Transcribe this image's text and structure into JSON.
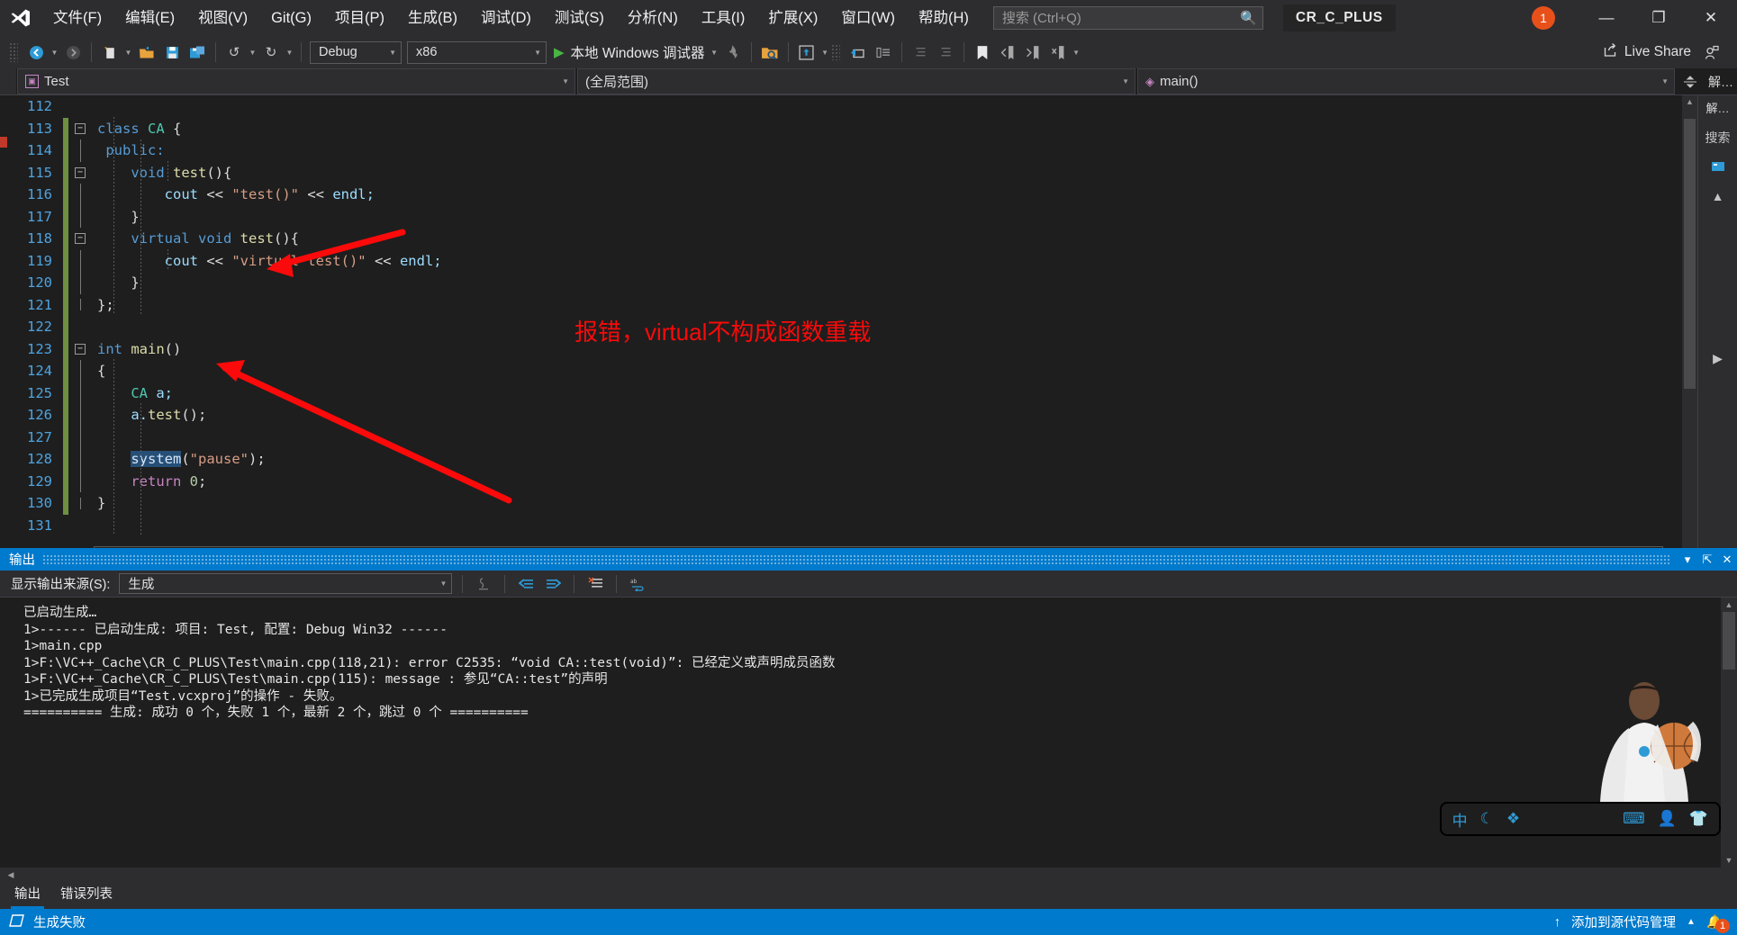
{
  "titlebar": {
    "logo_icon": "visual-studio-logo",
    "menus": [
      {
        "label": "文件(F)",
        "key": "F"
      },
      {
        "label": "编辑(E)",
        "key": "E"
      },
      {
        "label": "视图(V)",
        "key": "V"
      },
      {
        "label": "Git(G)",
        "key": "G"
      },
      {
        "label": "项目(P)",
        "key": "P"
      },
      {
        "label": "生成(B)",
        "key": "B"
      },
      {
        "label": "调试(D)",
        "key": "D"
      },
      {
        "label": "测试(S)",
        "key": "S"
      },
      {
        "label": "分析(N)",
        "key": "N"
      },
      {
        "label": "工具(I)",
        "key": "I"
      },
      {
        "label": "扩展(X)",
        "key": "X"
      },
      {
        "label": "窗口(W)",
        "key": "W"
      },
      {
        "label": "帮助(H)",
        "key": "H"
      }
    ],
    "search": {
      "placeholder": "搜索 (Ctrl+Q)",
      "value": "",
      "icon": "search-icon"
    },
    "solution_name": "CR_C_PLUS",
    "notification_count": "1",
    "window_buttons": {
      "minimize": "—",
      "maximize": "❐",
      "close": "✕"
    }
  },
  "toolbar": {
    "nav_back_icon": "navigate-back-icon",
    "nav_forward_icon": "navigate-forward-icon",
    "new_file_icon": "new-file-icon",
    "open_file_icon": "open-file-icon",
    "save_icon": "save-icon",
    "save_all_icon": "save-all-icon",
    "undo_icon": "undo-icon",
    "redo_icon": "redo-icon",
    "configuration": "Debug",
    "platform": "x86",
    "run_label": "本地 Windows 调试器",
    "hot_reload_icon": "hot-reload-icon",
    "search_folder_icon": "search-folder-icon",
    "solution_explorer_icon": "solution-explorer-icon",
    "properties_icon": "properties-icon",
    "toolbox_icon": "toolbox-icon",
    "indent_icons": [
      "decrease-indent-icon",
      "increase-indent-icon"
    ],
    "bookmark_icon": "bookmark-icon",
    "prev_bookmark_icon": "previous-bookmark-icon",
    "next_bookmark_icon": "next-bookmark-icon",
    "clear_bookmark_icon": "clear-bookmark-icon",
    "overflow_icon": "overflow-chevron-icon",
    "live_share_label": "Live Share",
    "live_share_icon": "share-icon",
    "account_icon": "account-icon"
  },
  "navbar": {
    "project": "Test",
    "project_icon": "project-icon",
    "scope": "(全局范围)",
    "member": "main()",
    "member_icon": "method-icon",
    "split_icon": "split-editor-icon",
    "right_label": "解…"
  },
  "editor": {
    "first_line": 112,
    "lines": [
      {
        "n": "112",
        "changed": false,
        "fold": "",
        "tokens": [
          {
            "t": "",
            "c": "pl"
          }
        ]
      },
      {
        "n": "113",
        "changed": true,
        "fold": "minus",
        "tokens": [
          {
            "t": "class ",
            "c": "kw"
          },
          {
            "t": "CA ",
            "c": "typ"
          },
          {
            "t": "{",
            "c": "pl"
          }
        ]
      },
      {
        "n": "114",
        "changed": true,
        "fold": "line",
        "tokens": [
          {
            "t": " public:",
            "c": "kw"
          }
        ]
      },
      {
        "n": "115",
        "changed": true,
        "fold": "minus",
        "tokens": [
          {
            "t": "    ",
            "c": "pl"
          },
          {
            "t": "void ",
            "c": "kw"
          },
          {
            "t": "test",
            "c": "fn"
          },
          {
            "t": "(){",
            "c": "pl"
          }
        ]
      },
      {
        "n": "116",
        "changed": true,
        "fold": "line",
        "tokens": [
          {
            "t": "        ",
            "c": "pl"
          },
          {
            "t": "cout ",
            "c": "var"
          },
          {
            "t": "<< ",
            "c": "pl"
          },
          {
            "t": "\"test()\"",
            "c": "str"
          },
          {
            "t": " << ",
            "c": "pl"
          },
          {
            "t": "endl;",
            "c": "var"
          }
        ]
      },
      {
        "n": "117",
        "changed": true,
        "fold": "line",
        "tokens": [
          {
            "t": "    }",
            "c": "pl"
          }
        ]
      },
      {
        "n": "118",
        "changed": true,
        "fold": "minus",
        "tokens": [
          {
            "t": "    ",
            "c": "pl"
          },
          {
            "t": "virtual void ",
            "c": "kw"
          },
          {
            "t": "test",
            "c": "fn"
          },
          {
            "t": "(){",
            "c": "pl"
          }
        ]
      },
      {
        "n": "119",
        "changed": true,
        "fold": "line",
        "tokens": [
          {
            "t": "        ",
            "c": "pl"
          },
          {
            "t": "cout ",
            "c": "var"
          },
          {
            "t": "<< ",
            "c": "pl"
          },
          {
            "t": "\"virtual test()\"",
            "c": "str"
          },
          {
            "t": " << ",
            "c": "pl"
          },
          {
            "t": "endl;",
            "c": "var"
          }
        ]
      },
      {
        "n": "120",
        "changed": true,
        "fold": "line",
        "tokens": [
          {
            "t": "    }",
            "c": "pl"
          }
        ]
      },
      {
        "n": "121",
        "changed": true,
        "fold": "end",
        "tokens": [
          {
            "t": "};",
            "c": "pl"
          }
        ]
      },
      {
        "n": "122",
        "changed": true,
        "fold": "",
        "tokens": [
          {
            "t": "",
            "c": "pl"
          }
        ]
      },
      {
        "n": "123",
        "changed": true,
        "fold": "minus",
        "tokens": [
          {
            "t": "int ",
            "c": "kw"
          },
          {
            "t": "main",
            "c": "fn"
          },
          {
            "t": "()",
            "c": "pl"
          }
        ]
      },
      {
        "n": "124",
        "changed": true,
        "fold": "line",
        "tokens": [
          {
            "t": "{",
            "c": "pl"
          }
        ]
      },
      {
        "n": "125",
        "changed": true,
        "fold": "line",
        "tokens": [
          {
            "t": "    ",
            "c": "pl"
          },
          {
            "t": "CA ",
            "c": "typ"
          },
          {
            "t": "a;",
            "c": "var"
          }
        ]
      },
      {
        "n": "126",
        "changed": true,
        "fold": "line",
        "tokens": [
          {
            "t": "    ",
            "c": "pl"
          },
          {
            "t": "a.",
            "c": "var"
          },
          {
            "t": "test",
            "c": "fn"
          },
          {
            "t": "();",
            "c": "pl"
          }
        ]
      },
      {
        "n": "127",
        "changed": true,
        "fold": "line",
        "tokens": [
          {
            "t": "",
            "c": "pl"
          }
        ]
      },
      {
        "n": "128",
        "changed": true,
        "fold": "line",
        "tokens": [
          {
            "t": "    ",
            "c": "pl"
          },
          {
            "t": "system",
            "c": "sel-word"
          },
          {
            "t": "(",
            "c": "pl"
          },
          {
            "t": "\"pause\"",
            "c": "str"
          },
          {
            "t": ");",
            "c": "pl"
          }
        ]
      },
      {
        "n": "129",
        "changed": true,
        "fold": "line",
        "tokens": [
          {
            "t": "    ",
            "c": "pl"
          },
          {
            "t": "return ",
            "c": "kw2"
          },
          {
            "t": "0",
            "c": "num"
          },
          {
            "t": ";",
            "c": "pl"
          }
        ]
      },
      {
        "n": "130",
        "changed": true,
        "fold": "end",
        "tokens": [
          {
            "t": "}",
            "c": "pl"
          }
        ]
      },
      {
        "n": "131",
        "changed": false,
        "fold": "",
        "tokens": [
          {
            "t": "",
            "c": "pl"
          }
        ]
      }
    ],
    "annotation": {
      "text": "报错，virtual不构成函数重载",
      "color": "#fa0a0a"
    }
  },
  "output": {
    "panel_title": "输出",
    "pin_icon": "pin-icon",
    "dropdown_icon": "window-menu-icon",
    "close_icon": "close-icon",
    "source_label": "显示输出来源(S):",
    "source_value": "生成",
    "toolbar_icons": [
      "find-message-icon",
      "go-to-previous-icon",
      "go-to-next-icon",
      "clear-all-icon",
      "toggle-word-wrap-icon"
    ],
    "lines": [
      "已启动生成…",
      "1>------ 已启动生成: 项目: Test, 配置: Debug Win32 ------",
      "1>main.cpp",
      "1>F:\\VC++_Cache\\CR_C_PLUS\\Test\\main.cpp(118,21): error C2535: “void CA::test(void)”: 已经定义或声明成员函数",
      "1>F:\\VC++_Cache\\CR_C_PLUS\\Test\\main.cpp(115): message : 参见“CA::test”的声明",
      "1>已完成生成项目“Test.vcxproj”的操作 - 失败。",
      "========== 生成: 成功 0 个，失败 1 个，最新 2 个，跳过 0 个 =========="
    ]
  },
  "float_toolbar": {
    "icons": [
      "aim-icon",
      "moon-icon",
      "sparkle-icon",
      "keyboard-icon",
      "person-icon",
      "shirt-icon"
    ]
  },
  "bottom_tabs": [
    {
      "label": "输出",
      "active": true
    },
    {
      "label": "错误列表",
      "active": false
    }
  ],
  "statusbar": {
    "status_icon": "build-status-icon",
    "status_text": "生成失败",
    "source_control_label": "添加到源代码管理",
    "source_control_up_icon": "arrow-up-icon",
    "source_control_caret": "caret-up-icon",
    "bell_icon": "bell-icon",
    "bell_count": "1"
  },
  "colors": {
    "accent": "#007acc",
    "titlebar_bg": "#2d2d30",
    "editor_bg": "#1e1e1e",
    "annotation_red": "#fa0a0a",
    "notification_orange": "#e8501a",
    "line_number": "#4ea3e0",
    "change_bar_green": "#6f8f41"
  }
}
